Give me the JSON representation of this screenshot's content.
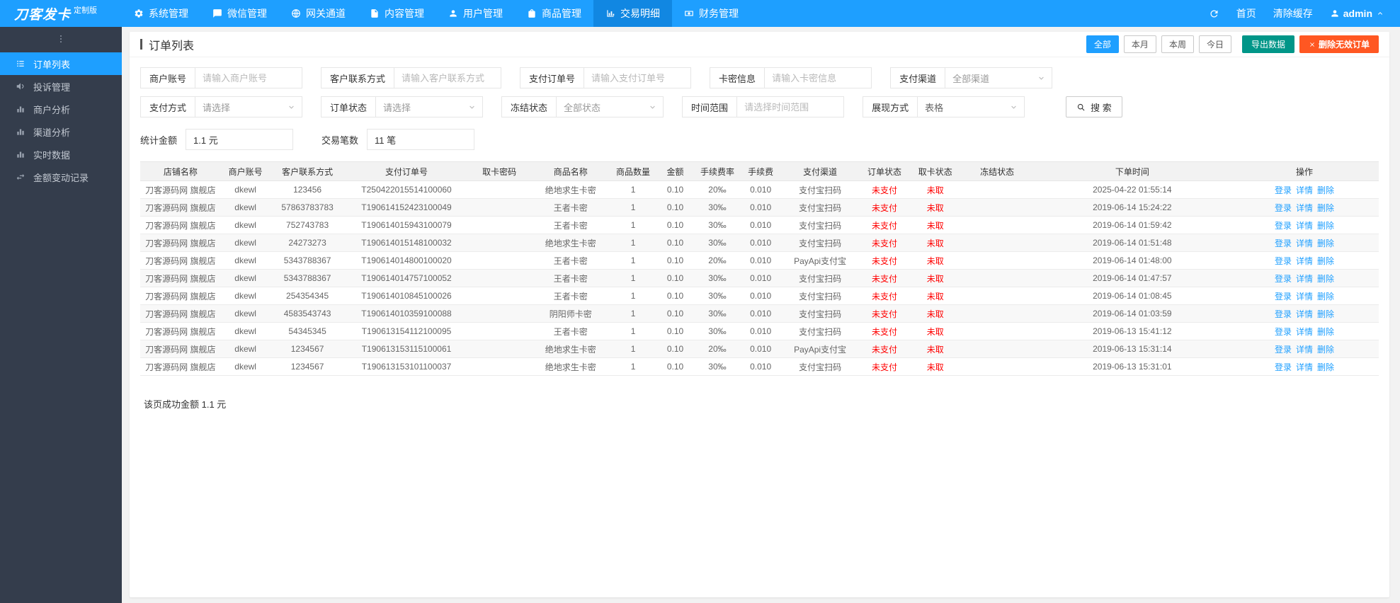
{
  "brand": {
    "name": "刀客发卡",
    "badge": "定制版"
  },
  "topnav": {
    "items": [
      {
        "label": "系统管理",
        "icon": "gear",
        "active": false
      },
      {
        "label": "微信管理",
        "icon": "chat",
        "active": false
      },
      {
        "label": "网关通道",
        "icon": "globe",
        "active": false
      },
      {
        "label": "内容管理",
        "icon": "doc",
        "active": false
      },
      {
        "label": "用户管理",
        "icon": "person",
        "active": false
      },
      {
        "label": "商品管理",
        "icon": "bag",
        "active": false
      },
      {
        "label": "交易明细",
        "icon": "chart",
        "active": true
      },
      {
        "label": "财务管理",
        "icon": "money",
        "active": false
      }
    ],
    "right": {
      "home": "首页",
      "clear_cache": "清除缓存",
      "user": "admin"
    }
  },
  "sidebar": {
    "items": [
      {
        "label": "订单列表",
        "icon": "list",
        "active": true
      },
      {
        "label": "投诉管理",
        "icon": "megaphone",
        "active": false
      },
      {
        "label": "商户分析",
        "icon": "barchart",
        "active": false
      },
      {
        "label": "渠道分析",
        "icon": "barchart",
        "active": false
      },
      {
        "label": "实时数据",
        "icon": "barchart",
        "active": false
      },
      {
        "label": "金额变动记录",
        "icon": "exchange",
        "active": false
      }
    ]
  },
  "page": {
    "title": "订单列表",
    "range_buttons": [
      "全部",
      "本月",
      "本周",
      "今日"
    ],
    "range_active": 0,
    "export_button": "导出数据",
    "delete_button": "删除无效订单"
  },
  "filters": {
    "row1": [
      {
        "label": "商户账号",
        "type": "input",
        "placeholder": "请输入商户账号"
      },
      {
        "label": "客户联系方式",
        "type": "input",
        "placeholder": "请输入客户联系方式"
      },
      {
        "label": "支付订单号",
        "type": "input",
        "placeholder": "请输入支付订单号"
      },
      {
        "label": "卡密信息",
        "type": "input",
        "placeholder": "请输入卡密信息"
      },
      {
        "label": "支付渠道",
        "type": "select",
        "value": "全部渠道",
        "muted": true
      }
    ],
    "row2": [
      {
        "label": "支付方式",
        "type": "select",
        "value": "请选择",
        "muted": true
      },
      {
        "label": "订单状态",
        "type": "select",
        "value": "请选择",
        "muted": true
      },
      {
        "label": "冻结状态",
        "type": "select",
        "value": "全部状态",
        "muted": true
      },
      {
        "label": "时间范围",
        "type": "input",
        "placeholder": "请选择时间范围"
      },
      {
        "label": "展现方式",
        "type": "select",
        "value": "表格",
        "muted": false
      }
    ],
    "search_button": "搜 索",
    "stats": [
      {
        "label": "统计金额",
        "value": "1.1 元"
      },
      {
        "label": "交易笔数",
        "value": "11 笔"
      }
    ]
  },
  "table": {
    "column_keys": [
      "shop",
      "merchant",
      "contact",
      "order_no",
      "card_pwd",
      "product",
      "qty",
      "amount",
      "fee_rate",
      "fee",
      "channel",
      "order_status",
      "card_status",
      "freeze_status",
      "time"
    ],
    "headers": [
      "店铺名称",
      "商户账号",
      "客户联系方式",
      "支付订单号",
      "取卡密码",
      "商品名称",
      "商品数量",
      "金额",
      "手续费率",
      "手续费",
      "支付渠道",
      "订单状态",
      "取卡状态",
      "冻结状态",
      "下单时间",
      "操作"
    ],
    "actions": [
      "登录",
      "详情",
      "删除"
    ],
    "rows": [
      {
        "shop": "刀客源码网 旗舰店",
        "merchant": "dkewl",
        "contact": "123456",
        "order_no": "T250422015514100060",
        "card_pwd": "",
        "product": "绝地求生卡密",
        "qty": "1",
        "amount": "0.10",
        "fee_rate": "20‰",
        "fee": "0.010",
        "channel": "支付宝扫码",
        "order_status": "未支付",
        "card_status": "未取",
        "freeze_status": "",
        "time": "2025-04-22 01:55:14"
      },
      {
        "shop": "刀客源码网 旗舰店",
        "merchant": "dkewl",
        "contact": "57863783783",
        "order_no": "T190614152423100049",
        "card_pwd": "",
        "product": "王者卡密",
        "qty": "1",
        "amount": "0.10",
        "fee_rate": "30‰",
        "fee": "0.010",
        "channel": "支付宝扫码",
        "order_status": "未支付",
        "card_status": "未取",
        "freeze_status": "",
        "time": "2019-06-14 15:24:22"
      },
      {
        "shop": "刀客源码网 旗舰店",
        "merchant": "dkewl",
        "contact": "752743783",
        "order_no": "T190614015943100079",
        "card_pwd": "",
        "product": "王者卡密",
        "qty": "1",
        "amount": "0.10",
        "fee_rate": "30‰",
        "fee": "0.010",
        "channel": "支付宝扫码",
        "order_status": "未支付",
        "card_status": "未取",
        "freeze_status": "",
        "time": "2019-06-14 01:59:42"
      },
      {
        "shop": "刀客源码网 旗舰店",
        "merchant": "dkewl",
        "contact": "24273273",
        "order_no": "T190614015148100032",
        "card_pwd": "",
        "product": "绝地求生卡密",
        "qty": "1",
        "amount": "0.10",
        "fee_rate": "30‰",
        "fee": "0.010",
        "channel": "支付宝扫码",
        "order_status": "未支付",
        "card_status": "未取",
        "freeze_status": "",
        "time": "2019-06-14 01:51:48"
      },
      {
        "shop": "刀客源码网 旗舰店",
        "merchant": "dkewl",
        "contact": "5343788367",
        "order_no": "T190614014800100020",
        "card_pwd": "",
        "product": "王者卡密",
        "qty": "1",
        "amount": "0.10",
        "fee_rate": "20‰",
        "fee": "0.010",
        "channel": "PayApi支付宝",
        "order_status": "未支付",
        "card_status": "未取",
        "freeze_status": "",
        "time": "2019-06-14 01:48:00"
      },
      {
        "shop": "刀客源码网 旗舰店",
        "merchant": "dkewl",
        "contact": "5343788367",
        "order_no": "T190614014757100052",
        "card_pwd": "",
        "product": "王者卡密",
        "qty": "1",
        "amount": "0.10",
        "fee_rate": "30‰",
        "fee": "0.010",
        "channel": "支付宝扫码",
        "order_status": "未支付",
        "card_status": "未取",
        "freeze_status": "",
        "time": "2019-06-14 01:47:57"
      },
      {
        "shop": "刀客源码网 旗舰店",
        "merchant": "dkewl",
        "contact": "254354345",
        "order_no": "T190614010845100026",
        "card_pwd": "",
        "product": "王者卡密",
        "qty": "1",
        "amount": "0.10",
        "fee_rate": "30‰",
        "fee": "0.010",
        "channel": "支付宝扫码",
        "order_status": "未支付",
        "card_status": "未取",
        "freeze_status": "",
        "time": "2019-06-14 01:08:45"
      },
      {
        "shop": "刀客源码网 旗舰店",
        "merchant": "dkewl",
        "contact": "4583543743",
        "order_no": "T190614010359100088",
        "card_pwd": "",
        "product": "阴阳师卡密",
        "qty": "1",
        "amount": "0.10",
        "fee_rate": "30‰",
        "fee": "0.010",
        "channel": "支付宝扫码",
        "order_status": "未支付",
        "card_status": "未取",
        "freeze_status": "",
        "time": "2019-06-14 01:03:59"
      },
      {
        "shop": "刀客源码网 旗舰店",
        "merchant": "dkewl",
        "contact": "54345345",
        "order_no": "T190613154112100095",
        "card_pwd": "",
        "product": "王者卡密",
        "qty": "1",
        "amount": "0.10",
        "fee_rate": "30‰",
        "fee": "0.010",
        "channel": "支付宝扫码",
        "order_status": "未支付",
        "card_status": "未取",
        "freeze_status": "",
        "time": "2019-06-13 15:41:12"
      },
      {
        "shop": "刀客源码网 旗舰店",
        "merchant": "dkewl",
        "contact": "1234567",
        "order_no": "T190613153115100061",
        "card_pwd": "",
        "product": "绝地求生卡密",
        "qty": "1",
        "amount": "0.10",
        "fee_rate": "20‰",
        "fee": "0.010",
        "channel": "PayApi支付宝",
        "order_status": "未支付",
        "card_status": "未取",
        "freeze_status": "",
        "time": "2019-06-13 15:31:14"
      },
      {
        "shop": "刀客源码网 旗舰店",
        "merchant": "dkewl",
        "contact": "1234567",
        "order_no": "T190613153101100037",
        "card_pwd": "",
        "product": "绝地求生卡密",
        "qty": "1",
        "amount": "0.10",
        "fee_rate": "30‰",
        "fee": "0.010",
        "channel": "支付宝扫码",
        "order_status": "未支付",
        "card_status": "未取",
        "freeze_status": "",
        "time": "2019-06-13 15:31:01"
      }
    ]
  },
  "footer": {
    "summary": "该页成功金额 1.1 元"
  },
  "colors": {
    "primary": "#1e9fff",
    "green": "#009688",
    "danger": "#ff5722",
    "status_red": "#ff0000",
    "sidebar_bg": "#343d4c"
  }
}
